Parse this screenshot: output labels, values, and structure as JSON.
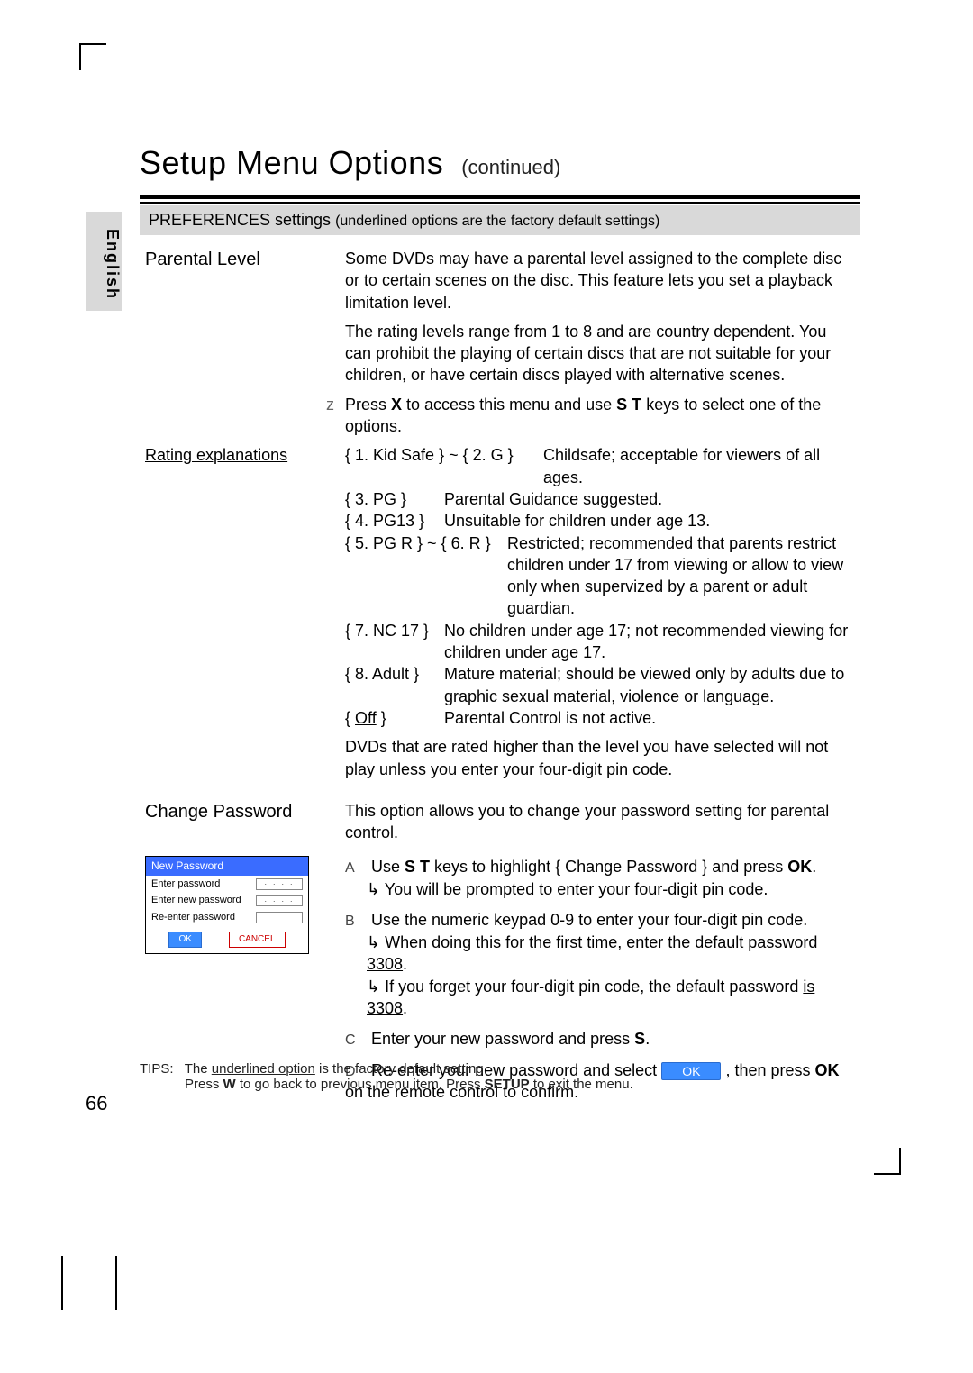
{
  "lang_tab": "English",
  "title": "Setup Menu Options",
  "title_cont": "(continued)",
  "section": {
    "head": "PREFERENCES settings",
    "head_sub": "(underlined options are the factory default settings)"
  },
  "parental": {
    "label": "Parental Level",
    "p1": "Some DVDs may have a parental level assigned to the complete disc or to certain scenes on the disc. This feature lets you set a playback limitation level.",
    "p2": "The rating levels range from 1 to 8 and are country dependent. You can prohibit the playing of certain discs that are not suitable for your children, or have certain discs played with alternative scenes.",
    "z_marker": "z",
    "p3a": "Press ",
    "p3x": "X",
    "p3b": " to access this menu and use ",
    "p3st": "S T",
    "p3c": " keys to select one of the options."
  },
  "ratings": {
    "label": "Rating explanations",
    "r1_key": "{ 1. Kid Safe } ~ { 2. G }",
    "r1_desc": "Childsafe; acceptable for viewers of all ages.",
    "r3_key": "{ 3. PG }",
    "r3_desc": "Parental Guidance suggested.",
    "r4_key": "{ 4. PG13 }",
    "r4_desc": "Unsuitable for children under age 13.",
    "r5_key": "{ 5. PG R } ~ { 6. R }",
    "r5_desc": "Restricted; recommended that parents restrict children under 17 from viewing or allow to view only when supervized by a parent or adult guardian.",
    "r7_key": "{ 7. NC 17 }",
    "r7_desc": "No children under age 17; not recommended viewing for children under age 17.",
    "r8_key": "{ 8. Adult  }",
    "r8_desc": "Mature material; should be viewed only by adults due to graphic sexual material, violence or language.",
    "off_key": "{ Off }",
    "off_label": "Off",
    "off_desc": "Parental Control is not active.",
    "note": "DVDs that are rated higher than the level you have selected will not play unless you enter your four-digit pin code."
  },
  "change_pw": {
    "label": "Change Password",
    "desc": "This option allows you to change your password setting for parental control.",
    "dialog": {
      "title": "New Password",
      "row1": "Enter password",
      "row2": "Enter new password",
      "row3": "Re-enter password",
      "dots": "· · · ·",
      "ok": "OK",
      "cancel": "CANCEL"
    },
    "steps": {
      "A": "A",
      "A_text_a": "Use ",
      "A_st": "S T",
      "A_text_b": " keys to highlight { Change Password } and press ",
      "A_ok": "OK",
      "A_text_c": ".",
      "A_sub": "You will be prompted to enter your four-digit pin code.",
      "B": "B",
      "B_text": "Use the numeric keypad 0-9 to enter your four-digit pin code.",
      "B_sub1a": "When doing this for the ﬁrst time, enter the default password ",
      "B_sub1b": "3308",
      "B_sub1c": ".",
      "B_sub2a": "If you forget your four-digit pin code, the default password ",
      "B_sub2b": "is 3308",
      "B_sub2c": ".",
      "C": "C",
      "C_text_a": "Enter your new password and press ",
      "C_ok": "S",
      "C_text_b": ".",
      "D": "D",
      "D_text_a": "Re-enter your new password and select ",
      "D_ok_btn": "OK",
      "D_text_b": ", then press ",
      "D_ok": "OK",
      "D_text_c": " on the remote control to conﬁrm."
    }
  },
  "tips": {
    "head": "TIPS:",
    "l1a": "The ",
    "l1u": "underlined option",
    "l1b": " is the factory default setting.",
    "l2a": "Press ",
    "l2w": "W",
    "l2b": " to go back to previous menu item. Press ",
    "l2s": "SETUP",
    "l2c": " to exit the menu."
  },
  "page_number": "66"
}
